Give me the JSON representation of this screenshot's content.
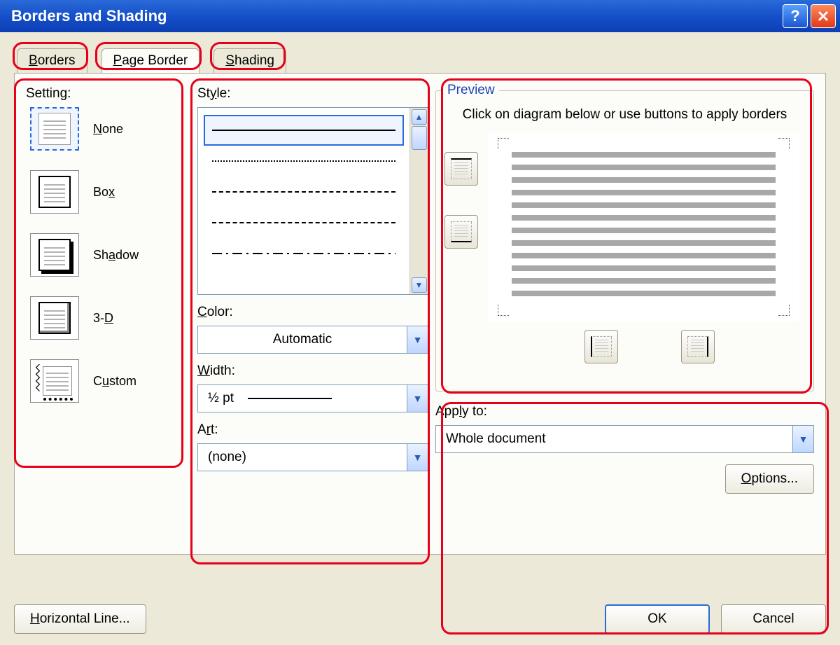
{
  "window": {
    "title": "Borders and Shading"
  },
  "tabs": {
    "borders": "Borders",
    "page_border": "Page Border",
    "shading": "Shading"
  },
  "setting": {
    "label": "Setting:",
    "none": "None",
    "box": "Box",
    "shadow": "Shadow",
    "threed": "3-D",
    "custom": "Custom"
  },
  "style": {
    "label": "Style:"
  },
  "color": {
    "label": "Color:",
    "value": "Automatic"
  },
  "width": {
    "label": "Width:",
    "value": "½ pt"
  },
  "art": {
    "label": "Art:",
    "value": "(none)"
  },
  "preview": {
    "title": "Preview",
    "hint": "Click on diagram below or use buttons to apply borders"
  },
  "apply_to": {
    "label": "Apply to:",
    "value": "Whole document"
  },
  "buttons": {
    "options": "Options...",
    "horizontal_line": "Horizontal Line...",
    "ok": "OK",
    "cancel": "Cancel"
  }
}
